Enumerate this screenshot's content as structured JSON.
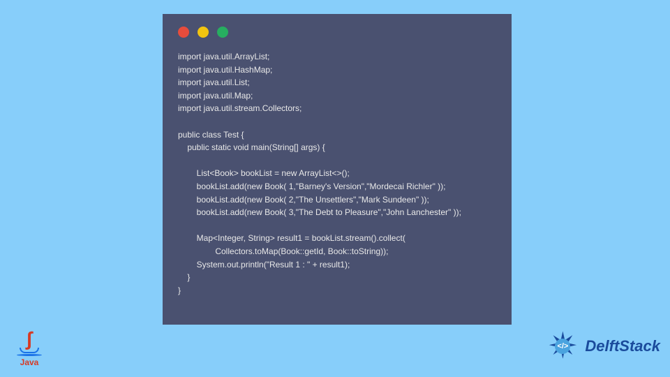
{
  "colors": {
    "background": "#87cefa",
    "window": "#4a5170",
    "dot_red": "#e74c3c",
    "dot_yellow": "#f1c40f",
    "dot_green": "#27ae60",
    "code_text": "#e8e8e8"
  },
  "code": "import java.util.ArrayList;\nimport java.util.HashMap;\nimport java.util.List;\nimport java.util.Map;\nimport java.util.stream.Collectors;\n\npublic class Test {\n    public static void main(String[] args) {\n\n        List<Book> bookList = new ArrayList<>();\n        bookList.add(new Book( 1,\"Barney's Version\",\"Mordecai Richler\" ));\n        bookList.add(new Book( 2,\"The Unsettlers\",\"Mark Sundeen\" ));\n        bookList.add(new Book( 3,\"The Debt to Pleasure\",\"John Lanchester\" ));\n\n        Map<Integer, String> result1 = bookList.stream().collect(\n                Collectors.toMap(Book::getId, Book::toString));\n        System.out.println(\"Result 1 : \" + result1);\n    }\n}",
  "java_logo": {
    "text": "Java"
  },
  "delftstack_logo": {
    "icon_text": "</>",
    "text": "DelftStack"
  }
}
